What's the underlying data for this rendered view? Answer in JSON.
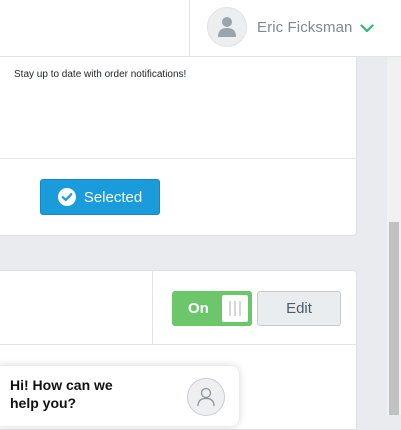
{
  "header": {
    "user_name": "Eric Ficksman",
    "avatar_icon": "user-silhouette-icon",
    "menu_icon": "chevron-down-icon",
    "accent_color": "#2eb872"
  },
  "notification_card": {
    "message": "Stay up to date with order notifications!",
    "selected_button_label": "Selected",
    "selected_icon": "check-circle-icon",
    "button_color": "#1a9bdb"
  },
  "integration_card": {
    "toggle_label": "On",
    "toggle_state": true,
    "toggle_color": "#6cc76a",
    "edit_button_label": "Edit"
  },
  "chat_widget": {
    "greeting": "Hi! How can we help you?",
    "agent_icon": "person-outline-icon"
  }
}
